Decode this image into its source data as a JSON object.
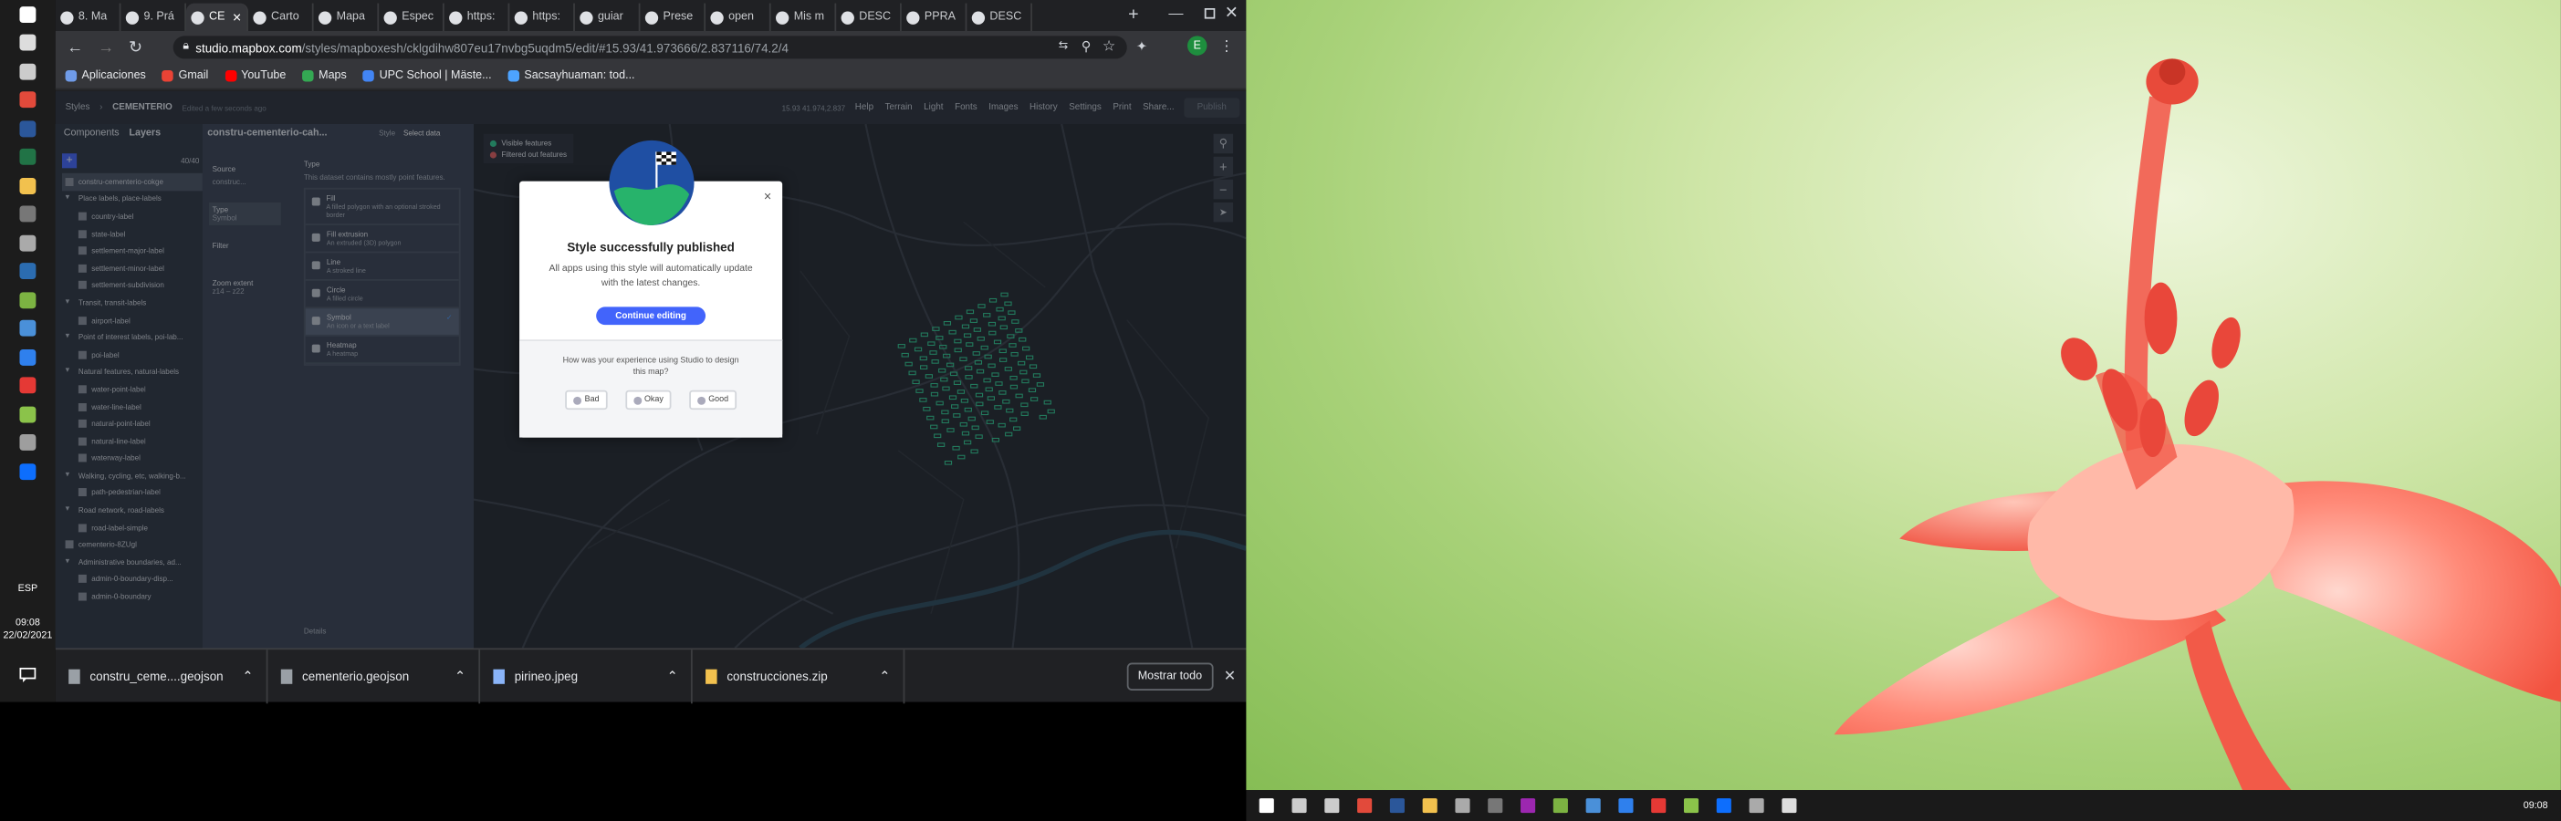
{
  "left_taskbar": {
    "clock": "09:08",
    "date": "22/02/2021",
    "lang": "ESP",
    "apps": [
      "start-icon",
      "search-icon",
      "task-view-icon",
      "chrome-icon",
      "word-icon",
      "excel-icon",
      "file-explorer-icon",
      "store-icon",
      "settings-icon",
      "mail-icon",
      "qgis-icon",
      "photo-icon",
      "vscode-icon",
      "acrobat-icon",
      "notes-icon",
      "app-icon",
      "terminal-icon"
    ]
  },
  "tabs": [
    {
      "label": "8. Ma"
    },
    {
      "label": "9. Prá"
    },
    {
      "label": "CE",
      "active": true
    },
    {
      "label": "Carto"
    },
    {
      "label": "Mapa"
    },
    {
      "label": "Espec"
    },
    {
      "label": "https:"
    },
    {
      "label": "https:"
    },
    {
      "label": "guiar"
    },
    {
      "label": "Prese"
    },
    {
      "label": "open"
    },
    {
      "label": "Mis m"
    },
    {
      "label": "DESC"
    },
    {
      "label": "PPRA"
    },
    {
      "label": "DESC"
    }
  ],
  "new_tab": "+",
  "address": {
    "host": "studio.mapbox.com",
    "path": "/styles/mapboxesh/cklgdihw807eu17nvbg5uqdm5/edit/#15.93/41.973666/2.837116/74.2/4"
  },
  "profile_initial": "E",
  "bookmarks": [
    {
      "label": "Aplicaciones",
      "icon": "apps-icon"
    },
    {
      "label": "Gmail",
      "icon": "gmail-icon"
    },
    {
      "label": "YouTube",
      "icon": "youtube-icon"
    },
    {
      "label": "Maps",
      "icon": "maps-icon"
    },
    {
      "label": "UPC School | Mäste...",
      "icon": "upc-icon"
    },
    {
      "label": "Sacsayhuaman: tod...",
      "icon": "m-icon"
    }
  ],
  "studio": {
    "styles": "Styles",
    "style_name": "CEMENTERIO",
    "saved": "Edited a few seconds ago",
    "coords": "15.93 41.974,2.837",
    "menu": [
      "Help",
      "Terrain",
      "Light",
      "Fonts",
      "Images",
      "History",
      "Settings",
      "Print",
      "Share..."
    ],
    "publish": "Publish",
    "panel_tabs": [
      "Components",
      "Layers"
    ],
    "layer_count": "40/40",
    "layers": [
      "constru-cementerio-cokge",
      "Place labels, place-labels",
      "country-label",
      "state-label",
      "settlement-major-label",
      "settlement-minor-label",
      "settlement-subdivision",
      "Transit, transit-labels",
      "airport-label",
      "Point of interest labels, poi-lab...",
      "poi-label",
      "Natural features, natural-labels",
      "water-point-label",
      "water-line-label",
      "natural-point-label",
      "natural-line-label",
      "waterway-label",
      "Walking, cycling, etc, walking-b...",
      "path-pedestrian-label",
      "Road network, road-labels",
      "road-label-simple",
      "cementerio-8ZUgl",
      "Administrative boundaries, ad...",
      "admin-0-boundary-disp...",
      "admin-0-boundary"
    ],
    "layer_title": "constru-cementerio-cah...",
    "layer_tabs": [
      "Style",
      "Select data"
    ],
    "source_label": "Source",
    "source_value": "construc...",
    "type_label": "Type",
    "type_value": "Symbol",
    "filter_label": "Filter",
    "zoom_label": "Zoom extent",
    "zoom_value": "z14 – z22",
    "type_hint": "This dataset contains mostly point features.",
    "types": [
      {
        "name": "Fill",
        "desc": "A filled polygon with an optional stroked border"
      },
      {
        "name": "Fill extrusion",
        "desc": "An extruded (3D) polygon"
      },
      {
        "name": "Line",
        "desc": "A stroked line"
      },
      {
        "name": "Circle",
        "desc": "A filled circle"
      },
      {
        "name": "Symbol",
        "desc": "An icon or a text label"
      },
      {
        "name": "Heatmap",
        "desc": "A heatmap"
      }
    ],
    "details": "Details",
    "legend": [
      "Visible features",
      "Filtered out features"
    ]
  },
  "modal": {
    "title": "Style successfully published",
    "body": "All apps using this style will automatically update with the latest changes.",
    "continue": "Continue editing",
    "survey": "How was your experience using Studio to design this map?",
    "ratings": [
      "Bad",
      "Okay",
      "Good"
    ],
    "close": "×"
  },
  "downloads": [
    {
      "name": "constru_ceme....geojson"
    },
    {
      "name": "cementerio.geojson"
    },
    {
      "name": "pirineo.jpeg"
    },
    {
      "name": "construcciones.zip"
    }
  ],
  "show_all": "Mostrar todo",
  "clock2": "09:08",
  "colors": {
    "accent": "#4264fb",
    "map_dots": "#2ecc91"
  }
}
